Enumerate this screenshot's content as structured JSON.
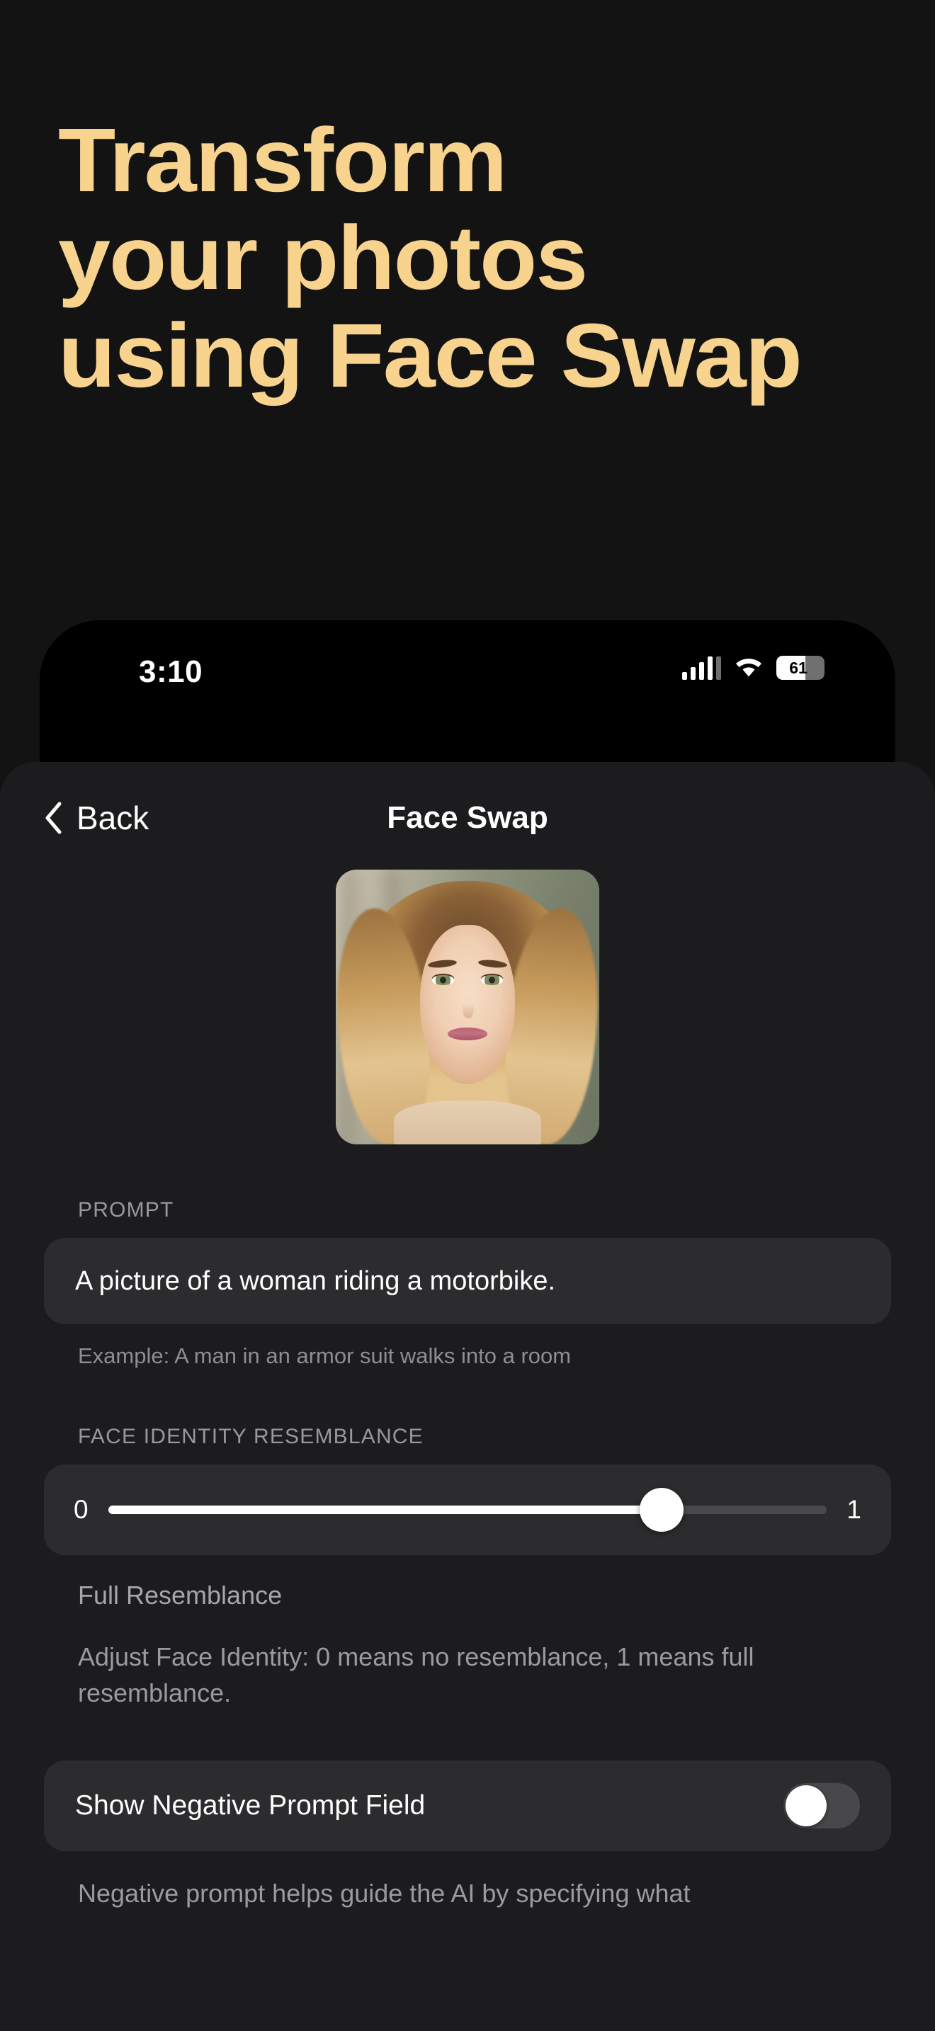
{
  "theme": {
    "page_bg": "#131313",
    "accent_gold": "#F8D38E",
    "sheet_bg": "#1C1C1E",
    "field_bg": "#2C2C2E",
    "text_primary": "#FFFFFF",
    "text_secondary": "#8E8E93"
  },
  "headline": {
    "line1": "Transform",
    "line2": "your photos",
    "line3": "using Face Swap"
  },
  "status_bar": {
    "time": "3:10",
    "cellular_icon": "cellular-bars-icon",
    "wifi_icon": "wifi-icon",
    "battery_percent": "61",
    "battery_icon": "battery-icon"
  },
  "nav": {
    "back_label": "Back",
    "back_icon": "chevron-left-icon",
    "title": "Face Swap"
  },
  "thumbnail": {
    "name": "source-face-photo",
    "alt": "Portrait of a blonde woman smiling"
  },
  "prompt": {
    "label": "PROMPT",
    "value": "A picture of a woman riding a motorbike.",
    "placeholder": "A picture of a woman riding a motorbike.",
    "helper": "Example: A man in an armor suit walks into a room"
  },
  "resemblance": {
    "label": "FACE IDENTITY RESEMBLANCE",
    "min": "0",
    "max": "1",
    "value_percent": 77,
    "caption": "Full Resemblance",
    "description": "Adjust Face Identity: 0 means no resemblance, 1 means full resemblance."
  },
  "negative_prompt": {
    "label": "Show Negative Prompt Field",
    "toggle_state": "off",
    "footnote": "Negative prompt helps guide the AI by specifying what"
  }
}
